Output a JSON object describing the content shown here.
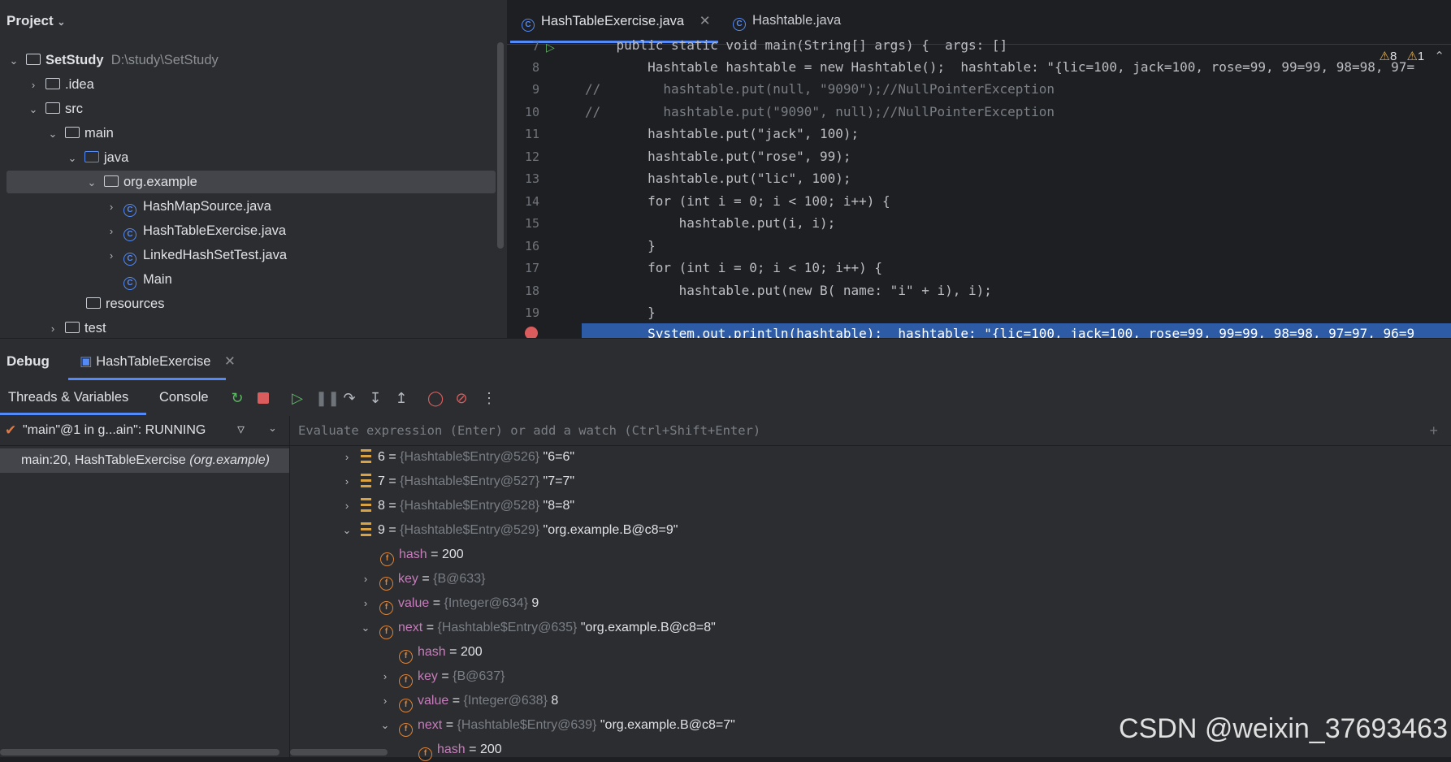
{
  "project_panel": {
    "title": "Project",
    "tree": [
      {
        "name": "SetStudy",
        "path": "D:\\study\\SetStudy"
      },
      {
        "name": ".idea"
      },
      {
        "name": "src"
      },
      {
        "name": "main"
      },
      {
        "name": "java"
      },
      {
        "name": "org.example"
      },
      {
        "name": "HashMapSource.java"
      },
      {
        "name": "HashTableExercise.java"
      },
      {
        "name": "LinkedHashSetTest.java"
      },
      {
        "name": "Main"
      },
      {
        "name": "resources"
      },
      {
        "name": "test"
      }
    ]
  },
  "editor": {
    "tabs": [
      {
        "label": "HashTableExercise.java",
        "active": true
      },
      {
        "label": "Hashtable.java",
        "active": false
      }
    ],
    "inspections": {
      "warnings": "8",
      "weak_warnings": "1"
    },
    "lines": [
      {
        "num": "7",
        "text": "    public static void main(String[] args) {  args: []"
      },
      {
        "num": "8",
        "text": "        Hashtable hashtable = new Hashtable();  hashtable: \"{lic=100, jack=100, rose=99, 99=99, 98=98, 97="
      },
      {
        "num": "9",
        "text": "//        hashtable.put(null, \"9090\");//NullPointerException"
      },
      {
        "num": "10",
        "text": "//        hashtable.put(\"9090\", null);//NullPointerException"
      },
      {
        "num": "11",
        "text": "        hashtable.put(\"jack\", 100);"
      },
      {
        "num": "12",
        "text": "        hashtable.put(\"rose\", 99);"
      },
      {
        "num": "13",
        "text": "        hashtable.put(\"lic\", 100);"
      },
      {
        "num": "14",
        "text": "        for (int i = 0; i < 100; i++) {"
      },
      {
        "num": "15",
        "text": "            hashtable.put(i, i);"
      },
      {
        "num": "16",
        "text": "        }"
      },
      {
        "num": "17",
        "text": "        for (int i = 0; i < 10; i++) {"
      },
      {
        "num": "18",
        "text": "            hashtable.put(new B( name: \"i\" + i), i);"
      },
      {
        "num": "19",
        "text": "        }"
      },
      {
        "num": "20",
        "text": "        System.out.println(hashtable);  hashtable: \"{lic=100, jack=100, rose=99, 99=99, 98=98, 97=97, 96=9"
      }
    ]
  },
  "debug": {
    "title": "Debug",
    "session_tab": "HashTableExercise",
    "subtabs": [
      "Threads & Variables",
      "Console"
    ],
    "thread": "\"main\"@1 in g...ain\": RUNNING",
    "frame": "main:20, HashTableExercise",
    "frame_pkg": "(org.example)",
    "eval_placeholder": "Evaluate expression (Enter) or add a watch (Ctrl+Shift+Enter)",
    "variables": [
      {
        "name": "6",
        "type": "{Hashtable$Entry@526}",
        "value": "\"6=6\"",
        "kind": "entry",
        "expanded": false
      },
      {
        "name": "7",
        "type": "{Hashtable$Entry@527}",
        "value": "\"7=7\"",
        "kind": "entry",
        "expanded": false
      },
      {
        "name": "8",
        "type": "{Hashtable$Entry@528}",
        "value": "\"8=8\"",
        "kind": "entry",
        "expanded": false
      },
      {
        "name": "9",
        "type": "{Hashtable$Entry@529}",
        "value": "\"org.example.B@c8=9\"",
        "kind": "entry",
        "expanded": true
      },
      {
        "name": "hash",
        "type": "",
        "value": "200",
        "kind": "field"
      },
      {
        "name": "key",
        "type": "{B@633}",
        "value": "",
        "kind": "field",
        "expanded": false
      },
      {
        "name": "value",
        "type": "{Integer@634}",
        "value": "9",
        "kind": "field",
        "expanded": false
      },
      {
        "name": "next",
        "type": "{Hashtable$Entry@635}",
        "value": "\"org.example.B@c8=8\"",
        "kind": "field",
        "expanded": true
      },
      {
        "name": "hash",
        "type": "",
        "value": "200",
        "kind": "field"
      },
      {
        "name": "key",
        "type": "{B@637}",
        "value": "",
        "kind": "field",
        "expanded": false
      },
      {
        "name": "value",
        "type": "{Integer@638}",
        "value": "8",
        "kind": "field",
        "expanded": false
      },
      {
        "name": "next",
        "type": "{Hashtable$Entry@639}",
        "value": "\"org.example.B@c8=7\"",
        "kind": "field",
        "expanded": true
      },
      {
        "name": "hash",
        "type": "",
        "value": "200",
        "kind": "field"
      }
    ]
  },
  "watermark": "CSDN @weixin_37693463"
}
